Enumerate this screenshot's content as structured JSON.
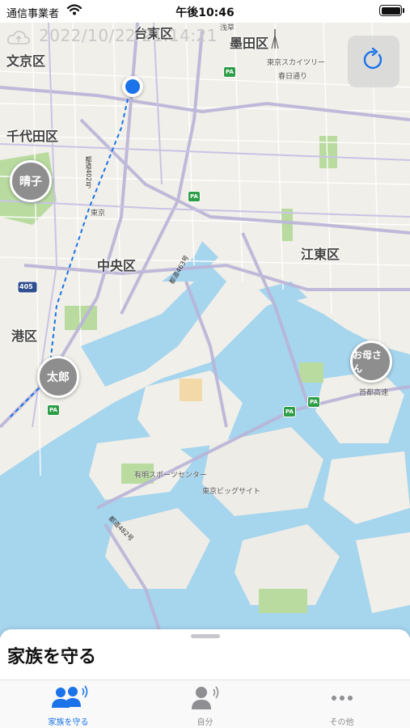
{
  "status_bar": {
    "carrier": "通信事業者",
    "time": "午後10:46"
  },
  "map": {
    "timestamp": "2022/10/22 21:14:21",
    "wards": {
      "bunkyo": "文京区",
      "taito": "台東区",
      "sumida": "墨田区",
      "chiyoda": "千代田区",
      "chuo": "中央区",
      "koto": "江東区",
      "minato": "港区"
    },
    "landmarks": {
      "skytree": "東京スカイツリー",
      "kasuga": "春日通り",
      "asakusa": "浅草",
      "ariake": "有明スポーツセンター",
      "bigsight": "東京ビッグサイト",
      "tokyo": "東京",
      "shutoko": "首都高速"
    },
    "roads": {
      "route_402": "都道402号",
      "route_463": "都道463号",
      "route_482": "都道482号",
      "route_405": "405"
    },
    "pa_badge": "PA",
    "people": [
      {
        "name": "晴子"
      },
      {
        "name": "太郎"
      },
      {
        "name": "お母さん"
      }
    ]
  },
  "sheet": {
    "title": "家族を守る"
  },
  "tabs": [
    {
      "label": "家族を守る",
      "icon": "family-icon",
      "active": true
    },
    {
      "label": "自分",
      "icon": "person-icon",
      "active": false
    },
    {
      "label": "その他",
      "icon": "more-icon",
      "active": false
    }
  ],
  "colors": {
    "accent": "#1a73e8",
    "water": "#a6d5ee",
    "land": "#f1efe9",
    "park": "#b9dba0",
    "pin": "#8e8e8e"
  }
}
